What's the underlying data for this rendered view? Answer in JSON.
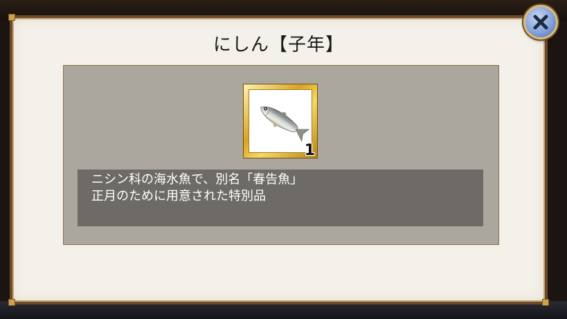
{
  "dialog": {
    "title": "にしん【子年】"
  },
  "item": {
    "icon": "herring-fish-icon",
    "count": "1"
  },
  "description": {
    "line1": "ニシン科の海水魚で、別名「春告魚」",
    "line2": "正月のために用意された特別品"
  },
  "colors": {
    "panel_bg": "#aba79f",
    "desc_bg": "#6e6b66",
    "frame_gold": "#d9a322",
    "close_blue": "#7e9cd4"
  }
}
